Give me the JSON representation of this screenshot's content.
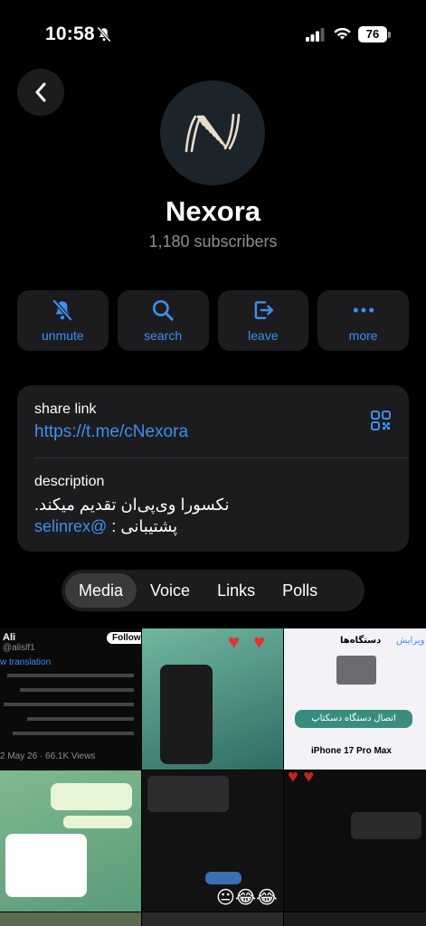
{
  "status_bar": {
    "time": "10:58",
    "battery": "76"
  },
  "channel": {
    "name": "Nexora",
    "subscribers": "1,180 subscribers"
  },
  "actions": [
    {
      "label": "unmute",
      "icon": "bell-slash-icon"
    },
    {
      "label": "search",
      "icon": "search-icon"
    },
    {
      "label": "leave",
      "icon": "leave-icon"
    },
    {
      "label": "more",
      "icon": "ellipsis-icon"
    }
  ],
  "info": {
    "share_label": "share link",
    "share_url": "https://t.me/cNexora",
    "description_label": "description",
    "description_line1": "نکسورا وی‌پی‌ان تقدیم میکند.",
    "description_line2_prefix": "پشتیبانی : ",
    "description_handle": "@selinrex"
  },
  "tabs": [
    "Media",
    "Voice",
    "Links",
    "Polls"
  ],
  "active_tab": "Media",
  "media": {
    "tile1": {
      "user": "Ali",
      "handle": "@alislf1",
      "follow": "Follow",
      "translation": "w translation",
      "date": "2 May 26 · 66.1K Views"
    },
    "tile3": {
      "title": "دستگاه‌ها",
      "edit": "ویرایش",
      "button": "اتصال دستگاه دسکتاپ",
      "device": "iPhone 17 Pro Max"
    }
  },
  "colors": {
    "accent": "#3e8ff0",
    "card": "#1c1c1e",
    "background": "#000000"
  }
}
